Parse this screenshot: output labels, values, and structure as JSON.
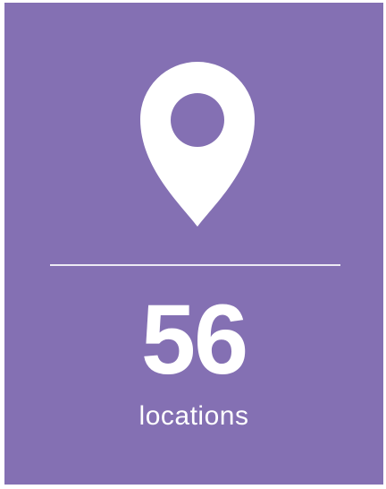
{
  "card": {
    "background_color": "#8470b3",
    "icon": "map-pin-icon",
    "value": "56",
    "label": "locations"
  }
}
